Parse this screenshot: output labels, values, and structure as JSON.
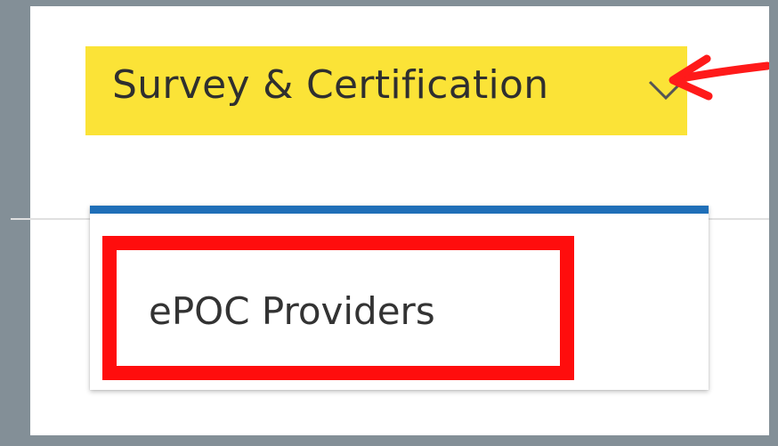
{
  "nav": {
    "menu_label": "Survey & Certification",
    "chevron_icon": "chevron-down-icon",
    "highlight_color": "#fbe337",
    "annotation": {
      "icon": "red-arrow-annotation-icon",
      "color": "#ff1a1a"
    }
  },
  "dropdown": {
    "accent_color": "#1f6fb8",
    "items": [
      {
        "label": "ePOC Providers",
        "highlight_color": "#ff0d0d"
      }
    ]
  }
}
